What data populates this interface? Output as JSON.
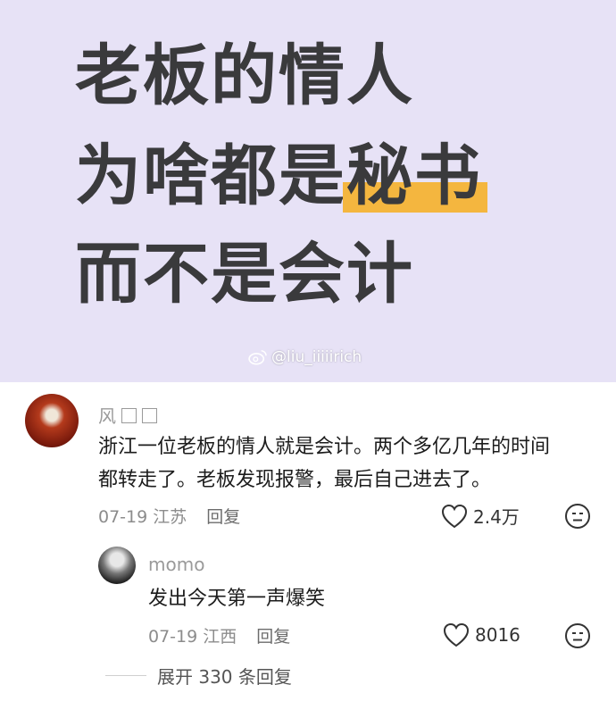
{
  "banner": {
    "line1": "老板的情人",
    "line2_prefix": "为啥都是",
    "line2_highlight": "秘书",
    "line3": "而不是会计",
    "watermark": "@liu_iiiiirich",
    "highlight_color": "#f4b63f",
    "background_color": "#e7e2f6"
  },
  "comments": [
    {
      "username": "风",
      "text_line1": "浙江一位老板的情人就是会计。两个多亿几年的时间",
      "text_line2": "都转走了。老板发现报警，最后自己进去了。",
      "date_location": "07-19 江苏",
      "reply_label": "回复",
      "likes": "2.4万"
    },
    {
      "username": "momo",
      "text": "发出今天第一声爆笑",
      "date_location": "07-19 江西",
      "reply_label": "回复",
      "likes": "8016"
    }
  ],
  "expand_replies": "展开 330 条回复",
  "icons": [
    "weibo-icon",
    "heart-icon",
    "emoji-face-icon"
  ]
}
